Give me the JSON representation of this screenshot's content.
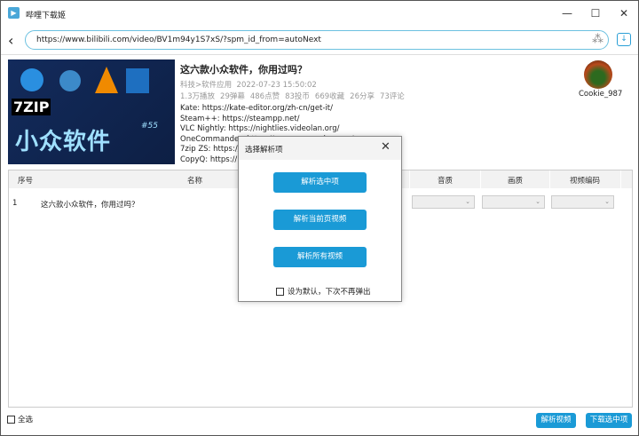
{
  "window": {
    "title": "哔哩下载姬",
    "minimize": "—",
    "maximize": "☐",
    "close": "✕"
  },
  "toolbar": {
    "back": "‹",
    "url": "https://www.bilibili.com/video/BV1m94y1S7xS/?spm_id_from=autoNext",
    "spinner": "⁂",
    "download_icon": "↓"
  },
  "video": {
    "thumbnail_text": "小众软件",
    "thumbnail_number": "#55",
    "thumbnail_zip": "7ZIP",
    "title": "这六款小众软件，你用过吗？",
    "category": "科技>软件应用",
    "date": "2022-07-23 15:50:02",
    "stats": [
      "1.3万播放",
      "29弹幕",
      "486点赞",
      "83投币",
      "669收藏",
      "26分享",
      "73评论"
    ],
    "description": [
      "Kate: https://kate-editor.org/zh-cn/get-it/",
      "Steam++: https://steampp.net/",
      "VLC Nightly: https://nightlies.videolan.org/",
      "OneCommander: https://onecommander.com/",
      "7zip ZS: https://g",
      "CopyQ: https://h"
    ],
    "uploader": "Cookie_987"
  },
  "table": {
    "headers": {
      "index": "序号",
      "name": "名称",
      "audio": "音质",
      "video": "画质",
      "codec": "视频编码"
    },
    "rows": [
      {
        "index": "1",
        "name": "这六款小众软件，你用过吗？",
        "audio": "",
        "video": "",
        "codec": ""
      }
    ]
  },
  "footer": {
    "select_all": "全选",
    "parse_button": "解析视频",
    "download_button": "下载选中项"
  },
  "dialog": {
    "title": "选择解析项",
    "close": "✕",
    "buttons": [
      "解析选中项",
      "解析当前页视频",
      "解析所有视频"
    ],
    "checkbox_label": "设为默认，下次不再弹出"
  },
  "colors": {
    "accent": "#1a9ad6",
    "url_border": "#6cc1e0"
  }
}
